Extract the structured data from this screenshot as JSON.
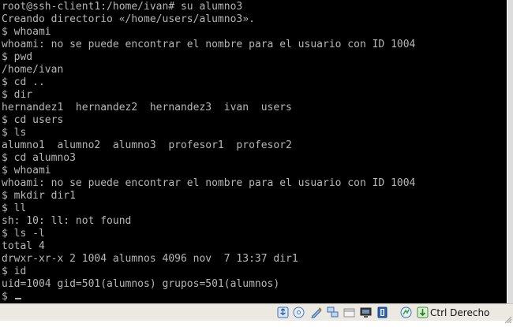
{
  "terminal": {
    "lines": [
      "root@ssh-client1:/home/ivan# su alumno3",
      "Creando directorio «/home/users/alumno3».",
      "$ whoami",
      "whoami: no se puede encontrar el nombre para el usuario con ID 1004",
      "$ pwd",
      "/home/ivan",
      "$ cd ..",
      "$ dir",
      "hernandez1  hernandez2  hernandez3  ivan  users",
      "$ cd users",
      "$ ls",
      "alumno1  alumno2  alumno3  profesor1  profesor2",
      "$ cd alumno3",
      "$ whoami",
      "whoami: no se puede encontrar el nombre para el usuario con ID 1004",
      "$ mkdir dir1",
      "$ ll",
      "sh: 10: ll: not found",
      "$ ls -l",
      "total 4",
      "drwxr-xr-x 2 1004 alumnos 4096 nov  7 13:37 dir1",
      "$ id",
      "uid=1004 gid=501(alumnos) grupos=501(alumnos)"
    ],
    "prompt": "$ ",
    "text_color": "#b7b7b7",
    "background": "#000000"
  },
  "statusbar": {
    "icons": [
      "usb-icon",
      "optical-drive-icon",
      "floppy-icon",
      "network-icon",
      "shared-folder-icon",
      "display-icon",
      "video-capture-icon",
      "cpu-icon",
      "mouse-integration-icon",
      "host-key-arrow-icon"
    ],
    "host_key_label": "Ctrl Derecho"
  }
}
